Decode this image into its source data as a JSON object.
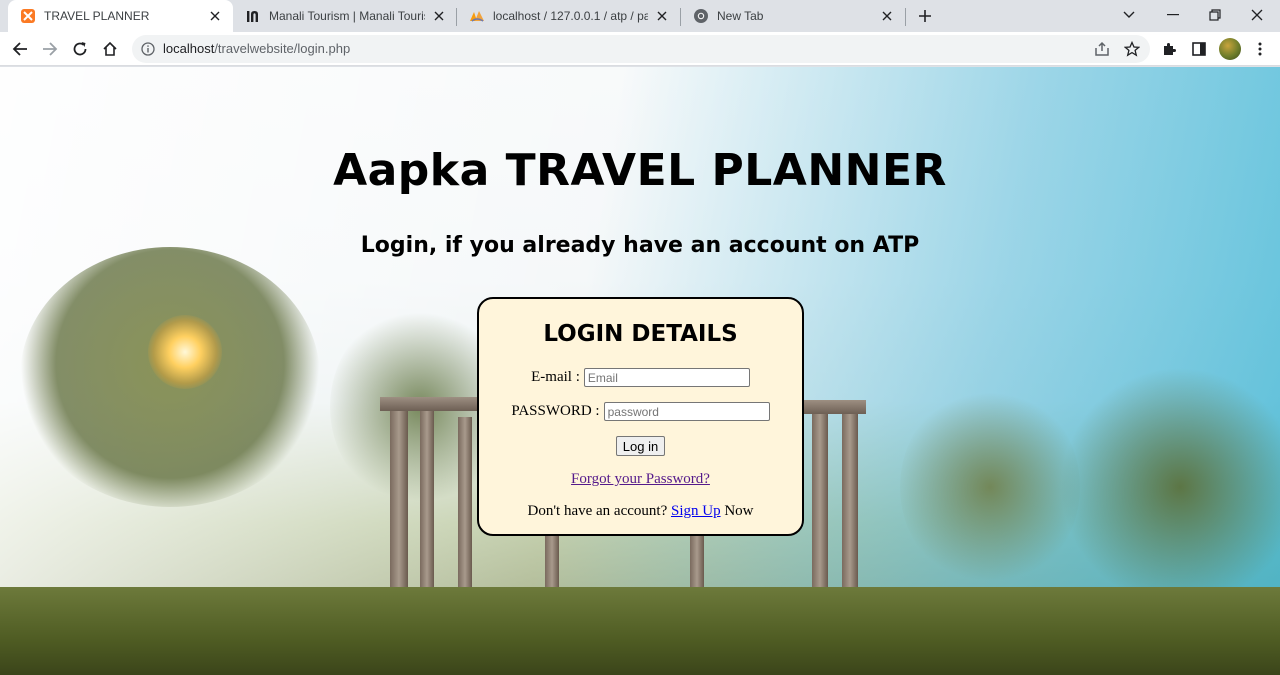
{
  "browser": {
    "tabs": [
      {
        "title": "TRAVEL PLANNER",
        "icon": "xampp-icon",
        "active": true
      },
      {
        "title": "Manali Tourism | Manali Tourist P",
        "icon": "holidify-icon",
        "active": false
      },
      {
        "title": "localhost / 127.0.0.1 / atp / packa",
        "icon": "phpmyadmin-icon",
        "active": false
      },
      {
        "title": "New Tab",
        "icon": "chrome-icon",
        "active": false
      }
    ],
    "url_host": "localhost",
    "url_path": "/travelwebsite/login.php"
  },
  "page": {
    "site_title": "Aapka TRAVEL PLANNER",
    "subtitle": "Login, if you already have an account on ATP",
    "login": {
      "heading": "LOGIN DETAILS",
      "email_label": "E-mail :",
      "email_placeholder": "Email",
      "password_label": "PASSWORD :",
      "password_placeholder": "password",
      "submit_label": "Log in",
      "forgot_link": "Forgot your Password?",
      "signup_prefix": "Don't have an account?",
      "signup_link": "Sign Up",
      "signup_suffix": "Now"
    }
  },
  "colors": {
    "login_box_bg": "#fff5db",
    "active_tab_bg": "#ffffff",
    "tabstrip_bg": "#dee1e6"
  }
}
